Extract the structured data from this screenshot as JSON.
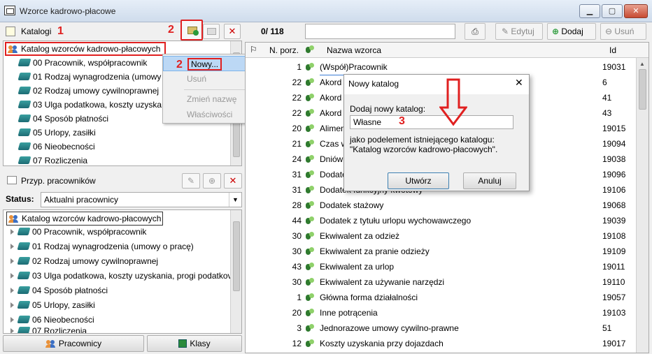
{
  "window": {
    "title": "Wzorce kadrowo-płacowe",
    "min": "▁",
    "max": "▢",
    "close": "✕"
  },
  "catalogs_panel": {
    "title": "Katalogi",
    "annotation": "1",
    "annotation2": "2"
  },
  "catalog_tree": {
    "root": "Katalog wzorców kadrowo-płacowych",
    "items": [
      "00 Pracownik, współpracownik",
      "01 Rodzaj wynagrodzenia (umowy",
      "02 Rodzaj umowy cywilnoprawnej",
      "03 Ulga podatkowa, koszty uzyskan",
      "04 Sposób płatności",
      "05 Urlopy, zasiłki",
      "06 Nieobecności",
      "07 Rozliczenia"
    ]
  },
  "context_menu": {
    "annotation": "2",
    "items": [
      "Nowy...",
      "Usuń",
      "Zmień nazwę",
      "Właściwości"
    ]
  },
  "assign_panel": {
    "title": "Przyp. pracowników",
    "status_label": "Status:",
    "status_value": "Aktualni pracownicy"
  },
  "assign_tree": {
    "root": "Katalog wzorców kadrowo-płacowych",
    "items": [
      "00 Pracownik, współpracownik",
      "01 Rodzaj wynagrodzenia (umowy o pracę)",
      "02 Rodzaj umowy cywilnoprawnej",
      "03 Ulga podatkowa, koszty uzyskania, progi podatkov",
      "04 Sposób płatności",
      "05 Urlopy, zasiłki",
      "06 Nieobecności",
      "07 Rozliczenia"
    ]
  },
  "bottom_tabs": {
    "left": "Pracownicy",
    "right": "Klasy"
  },
  "toolbar": {
    "count": "0/ 118",
    "search_value": "",
    "edit": "Edytuj",
    "add": "Dodaj",
    "remove": "Usuń"
  },
  "grid": {
    "headers": {
      "flag": "",
      "nporz": "N. porz.",
      "name": "Nazwa wzorca",
      "id": "Id"
    },
    "rows": [
      {
        "n": "1",
        "name": "(Współ)Pracownik",
        "id": "19031"
      },
      {
        "n": "22",
        "name": "Akord",
        "id": "6"
      },
      {
        "n": "22",
        "name": "Akord",
        "id": "41"
      },
      {
        "n": "22",
        "name": "Akord",
        "id": "43"
      },
      {
        "n": "20",
        "name": "Alimen",
        "id": "19015"
      },
      {
        "n": "21",
        "name": "Czas w",
        "id": "19094"
      },
      {
        "n": "24",
        "name": "Dniów",
        "id": "19038"
      },
      {
        "n": "31",
        "name": "Dodatek",
        "id": "19096"
      },
      {
        "n": "31",
        "name": "Dodatek funkcyjny kwotowy",
        "id": "19106"
      },
      {
        "n": "28",
        "name": "Dodatek stażowy",
        "id": "19068"
      },
      {
        "n": "44",
        "name": "Dodatek z tytułu urlopu wychowawczego",
        "id": "19039"
      },
      {
        "n": "30",
        "name": "Ekwiwalent za odzież",
        "id": "19108"
      },
      {
        "n": "30",
        "name": "Ekwiwalent za pranie odzieży",
        "id": "19109"
      },
      {
        "n": "43",
        "name": "Ekwiwalent za urlop",
        "id": "19011"
      },
      {
        "n": "30",
        "name": "Ekwiwalent za używanie narzędzi",
        "id": "19110"
      },
      {
        "n": "1",
        "name": "Główna forma działalności",
        "id": "19057"
      },
      {
        "n": "20",
        "name": "Inne potrącenia",
        "id": "19103"
      },
      {
        "n": "3",
        "name": "Jednorazowe umowy cywilno-prawne",
        "id": "51"
      },
      {
        "n": "12",
        "name": "Koszty uzyskania przy dojazdach",
        "id": "19017"
      }
    ]
  },
  "dialog": {
    "title": "Nowy katalog",
    "close": "✕",
    "label": "Dodaj nowy katalog:",
    "value": "Własne",
    "annotation": "3",
    "info1": "jako podelement istniejącego katalogu:",
    "info2": "\"Katalog wzorców kadrowo-płacowych\".",
    "ok": "Utwórz",
    "cancel": "Anuluj"
  }
}
